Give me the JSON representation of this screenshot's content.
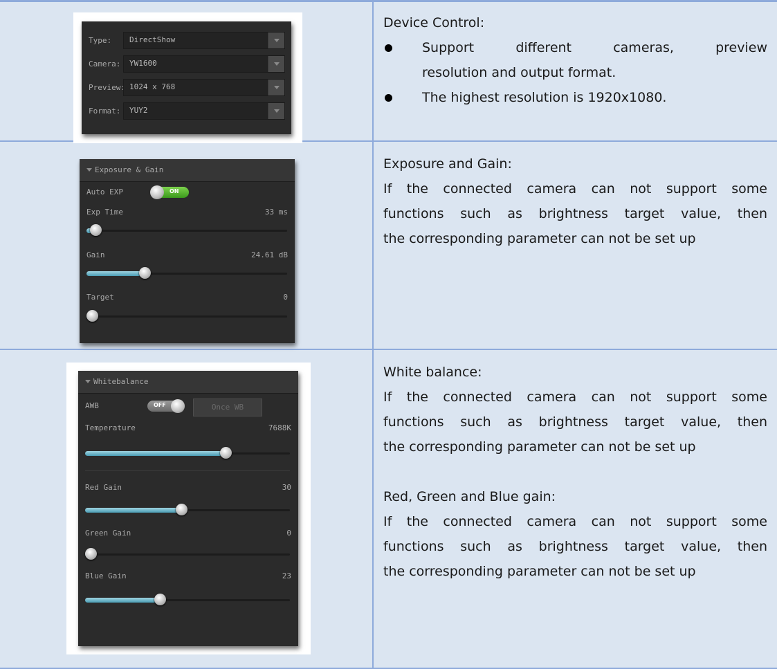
{
  "device": {
    "rows": [
      {
        "label": "Type:",
        "value": "DirectShow"
      },
      {
        "label": "Camera:",
        "value": "YW1600"
      },
      {
        "label": "Preview:",
        "value": "1024 x 768"
      },
      {
        "label": "Format:",
        "value": "YUY2"
      }
    ],
    "heading": "Device Control:",
    "bullets": [
      {
        "line1": "Support different cameras, preview",
        "line2": "resolution and output format."
      },
      {
        "line1": "The highest resolution is 1920x1080."
      }
    ]
  },
  "exposure": {
    "section_title": "Exposure & Gain",
    "auto_exp_label": "Auto EXP",
    "auto_exp_state": "ON",
    "exp_time_label": "Exp Time",
    "exp_time_value": "33 ms",
    "exp_time_level": 0.02,
    "gain_label": "Gain",
    "gain_value": "24.61 dB",
    "gain_level": 0.28,
    "target_label": "Target",
    "target_value": "0",
    "target_level": 0.0,
    "heading": "Exposure and Gain:",
    "desc_lines": [
      "If the connected camera can not support some",
      "functions such as brightness target value, then",
      "the corresponding parameter can not be set up"
    ]
  },
  "whitebalance": {
    "section_title": "Whitebalance",
    "awb_label": "AWB",
    "awb_state": "OFF",
    "once_wb_label": "Once WB",
    "temperature_label": "Temperature",
    "temperature_value": "7688K",
    "temperature_level": 0.7,
    "red_gain_label": "Red Gain",
    "red_gain_value": "30",
    "red_gain_level": 0.47,
    "green_gain_label": "Green Gain",
    "green_gain_value": "0",
    "green_gain_level": 0.0,
    "blue_gain_label": "Blue Gain",
    "blue_gain_value": "23",
    "blue_gain_level": 0.36,
    "heading": "White balance:",
    "desc_lines": [
      "If the connected camera can not support some",
      "functions such as brightness target value, then",
      "the corresponding parameter can not be set up"
    ],
    "rgb_heading": "Red, Green and Blue gain:",
    "rgb_desc_lines": [
      "If the connected camera can not support some",
      "functions such as brightness target value, then",
      "the corresponding parameter can not be set up"
    ]
  }
}
